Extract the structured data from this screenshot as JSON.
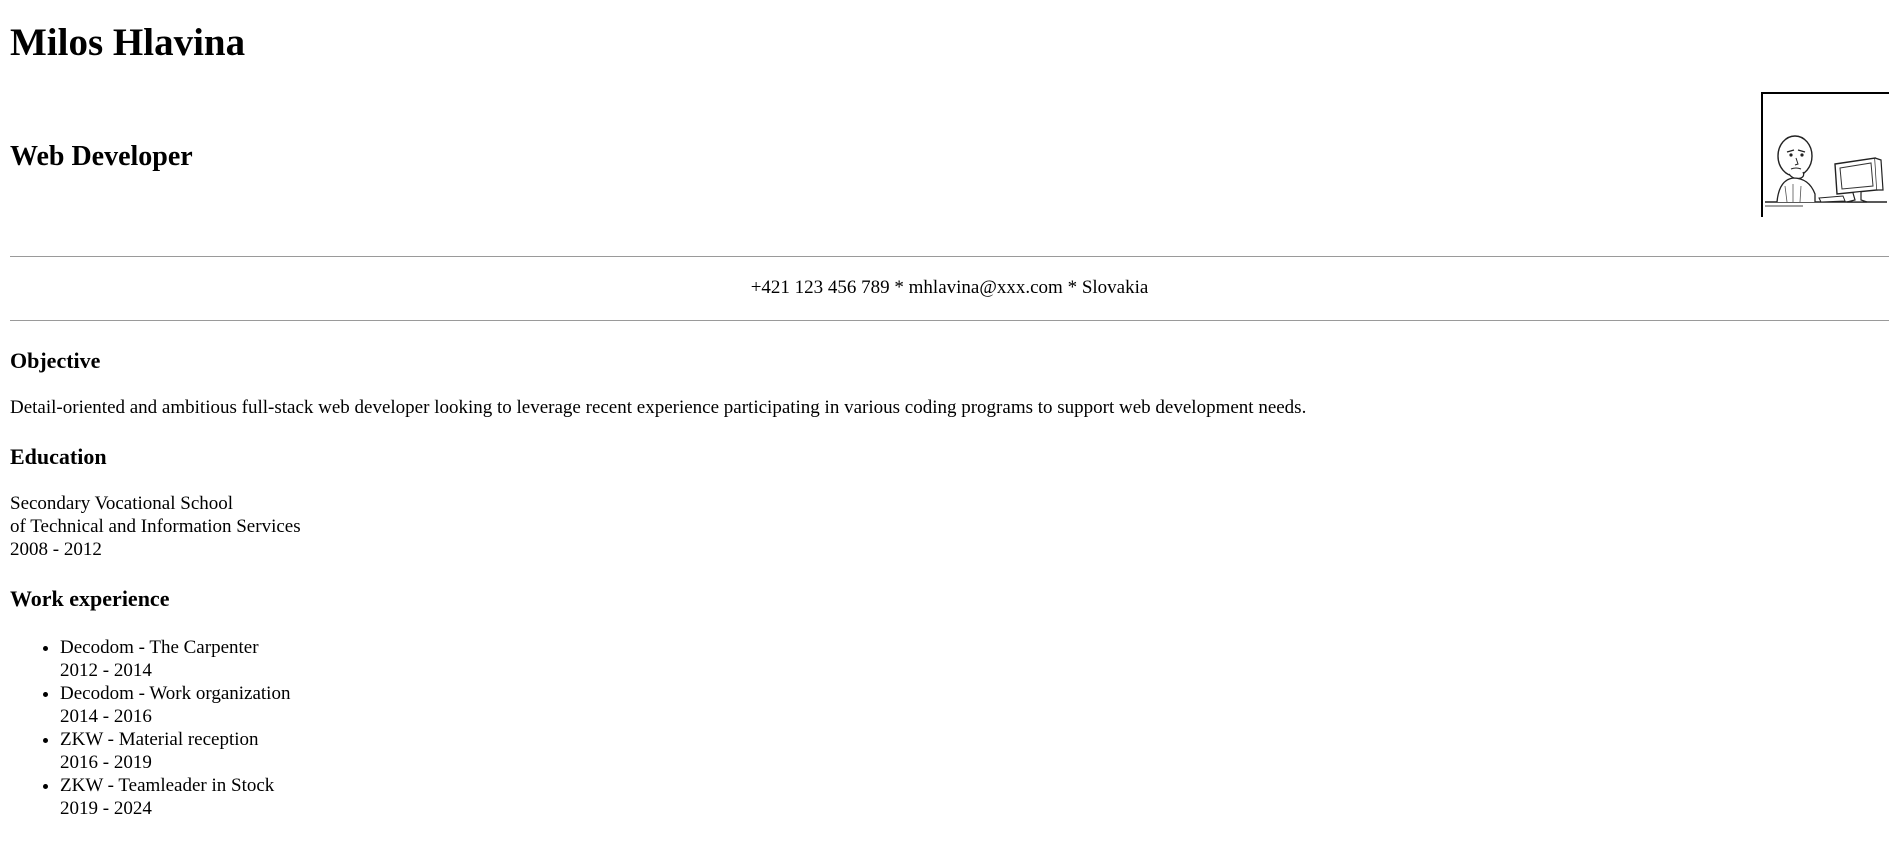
{
  "header": {
    "name": "Milos Hlavina",
    "title": "Web Developer"
  },
  "photo": {
    "icon": "computer-guy-meme-icon"
  },
  "contact": {
    "text": "+421 123 456 789 * mhlavina@xxx.com * Slovakia"
  },
  "objective": {
    "heading": "Objective",
    "text": "Detail-oriented and ambitious full-stack web developer looking to leverage recent experience participating in various coding programs to support web development needs."
  },
  "education": {
    "heading": "Education",
    "line1": "Secondary Vocational School",
    "line2": "of Technical and Information Services",
    "years": "2008 - 2012"
  },
  "work": {
    "heading": "Work experience",
    "items": [
      {
        "role": "Decodom - The Carpenter",
        "years": "2012 - 2014"
      },
      {
        "role": "Decodom - Work organization",
        "years": "2014 - 2016"
      },
      {
        "role": "ZKW - Material reception",
        "years": "2016 - 2019"
      },
      {
        "role": "ZKW - Teamleader in Stock",
        "years": "2019 - 2024"
      }
    ]
  }
}
